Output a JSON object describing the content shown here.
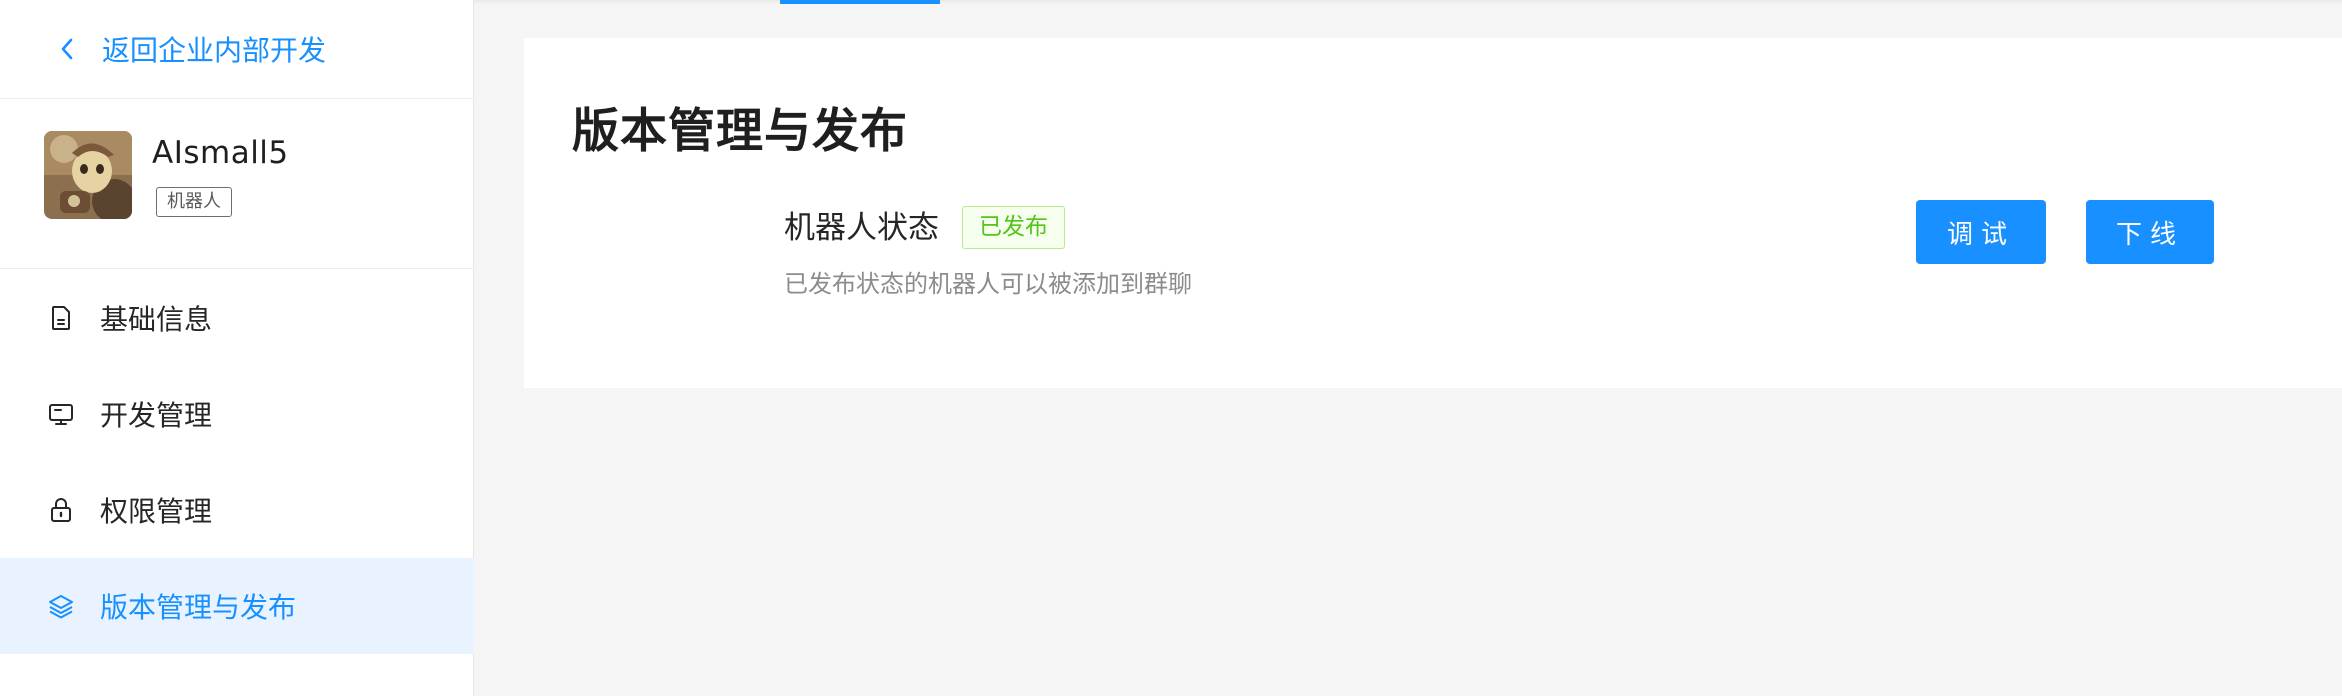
{
  "sidebar": {
    "back_label": "返回企业内部开发",
    "app": {
      "name": "AIsmall5",
      "tag": "机器人"
    },
    "items": [
      {
        "label": "基础信息",
        "icon": "document-icon",
        "active": false
      },
      {
        "label": "开发管理",
        "icon": "monitor-icon",
        "active": false
      },
      {
        "label": "权限管理",
        "icon": "lock-icon",
        "active": false
      },
      {
        "label": "版本管理与发布",
        "icon": "layers-icon",
        "active": true
      }
    ]
  },
  "main": {
    "title": "版本管理与发布",
    "status": {
      "label": "机器人状态",
      "badge": "已发布",
      "description": "已发布状态的机器人可以被添加到群聊"
    },
    "buttons": {
      "debug": "调试",
      "offline": "下线"
    }
  },
  "colors": {
    "accent": "#1890ff",
    "active_bg": "#e8f3ff",
    "badge_green": "#52c41a",
    "badge_bg": "#f6ffed",
    "badge_border": "#b7eb8f",
    "page_bg": "#f5f5f5"
  }
}
